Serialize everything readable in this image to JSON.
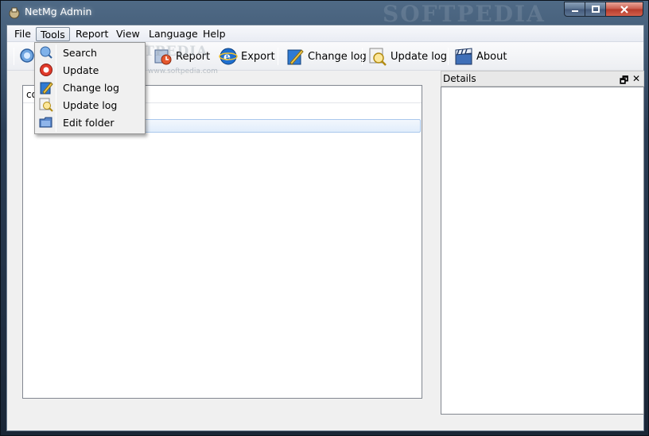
{
  "window": {
    "title": "NetMg Admin",
    "watermark": "SOFTPEDIA",
    "watermark_small": "www.softpedia.com"
  },
  "menubar": {
    "items": [
      {
        "label": "File"
      },
      {
        "label": "Tools"
      },
      {
        "label": "Report"
      },
      {
        "label": "View"
      },
      {
        "label": "Language"
      },
      {
        "label": "Help"
      }
    ],
    "active": "Tools"
  },
  "toolbar": {
    "report_label": "Report",
    "export_label": "Export",
    "changelog_label": "Change log",
    "updatelog_label": "Update log",
    "about_label": "About"
  },
  "tools_menu": {
    "items": [
      {
        "label": "Search",
        "icon": "search-icon"
      },
      {
        "label": "Update",
        "icon": "update-icon"
      },
      {
        "label": "Change log",
        "icon": "change-log-icon"
      },
      {
        "label": "Update log",
        "icon": "update-log-icon"
      },
      {
        "label": "Edit folder",
        "icon": "edit-folder-icon"
      }
    ]
  },
  "left_panel": {
    "header_text": "co"
  },
  "details_panel": {
    "title": "Details",
    "float_glyph": "🗗",
    "close_glyph": "✕"
  },
  "colors": {
    "titlebar": "#2b3e56",
    "client_bg": "#f0f0f0",
    "selection": "#e1edfb"
  }
}
